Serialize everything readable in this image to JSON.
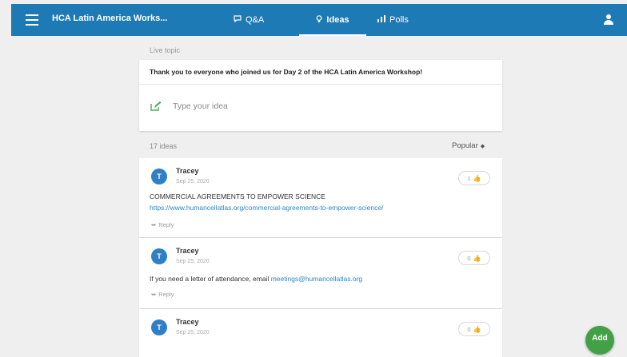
{
  "header": {
    "event_title": "HCA Latin America Works...",
    "tabs": [
      {
        "label": "Q&A",
        "icon": "chat-bubble-icon"
      },
      {
        "label": "Ideas",
        "icon": "lightbulb-icon",
        "active": true
      },
      {
        "label": "Polls",
        "icon": "bar-chart-icon"
      }
    ],
    "bar_color": "#1e7ab5"
  },
  "live_topic": {
    "label": "Live topic",
    "text": "Thank you to everyone who joined us for Day 2 of the HCA Latin America Workshop!",
    "input_placeholder": "Type your idea"
  },
  "ideas_header": {
    "count_label": "17 ideas",
    "sort_label": "Popular"
  },
  "ideas": [
    {
      "avatar_letter": "T",
      "author": "Tracey",
      "date": "Sep 25, 2020",
      "likes": "1",
      "text": "COMMERCIAL AGREEMENTS TO EMPOWER SCIENCE",
      "link": "https://www.humancellatlas.org/commercial-agreements-to-empower-science/",
      "reply_label": "Reply"
    },
    {
      "avatar_letter": "T",
      "author": "Tracey",
      "date": "Sep 25, 2020",
      "likes": "0",
      "text": "If you need a letter of attendance, email ",
      "inline_link": "meetings@humancellatlas.org",
      "reply_label": "Reply"
    },
    {
      "avatar_letter": "T",
      "author": "Tracey",
      "date": "Sep 25, 2020",
      "likes": "0"
    }
  ],
  "fab": {
    "label": "Add",
    "color": "#43a047"
  }
}
